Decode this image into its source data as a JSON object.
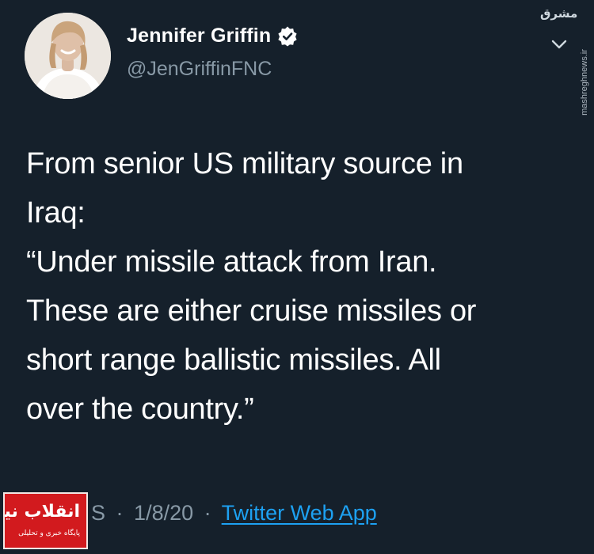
{
  "author": {
    "display_name": "Jennifer Griffin",
    "handle": "@JenGriffinFNC",
    "verified": true,
    "avatar": "avatar"
  },
  "tweet": {
    "lines": [
      "From senior US military source in",
      "Iraq:",
      "“Under missile attack from Iran.",
      "These are either cruise missiles or",
      "short range ballistic missiles. All",
      "over the country.”"
    ]
  },
  "meta": {
    "time_fragment": "S",
    "date": "1/8/20",
    "separator": "·",
    "source_app": "Twitter Web App"
  },
  "overlays": {
    "source_logo_text": "مشرق",
    "source_url": "mashreghnews.ir",
    "watermark_title": "انقلاب نیوز",
    "watermark_subtitle": "پایگاه خبری و تحلیلی"
  },
  "colors": {
    "background": "#15202b",
    "text_primary": "#ffffff",
    "text_secondary": "#8899a6",
    "link": "#1da1f2",
    "watermark_red": "#d21a1e"
  },
  "icons": {
    "verified": "verified-badge-icon",
    "more": "chevron-down-icon"
  }
}
